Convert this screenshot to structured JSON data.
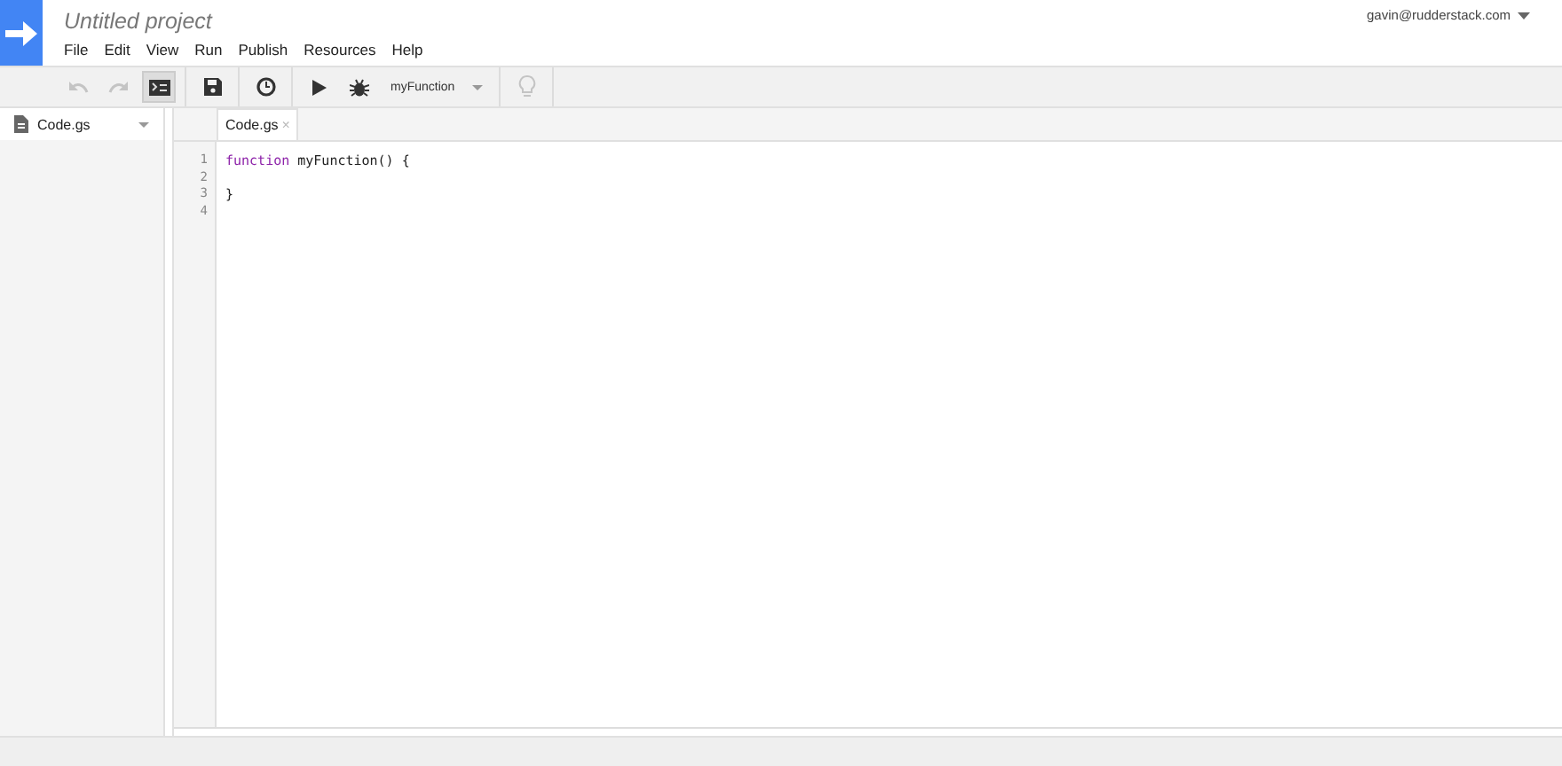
{
  "project": {
    "title": "Untitled project"
  },
  "menu": [
    "File",
    "Edit",
    "View",
    "Run",
    "Publish",
    "Resources",
    "Help"
  ],
  "account": {
    "email": "gavin@rudderstack.com"
  },
  "toolbar": [
    {
      "kind": "undo",
      "disabled": true,
      "pressed": false
    },
    {
      "kind": "redo",
      "disabled": true,
      "pressed": false
    },
    {
      "kind": "log",
      "disabled": false,
      "pressed": true
    },
    {
      "kind": "sep"
    },
    {
      "kind": "save",
      "disabled": false,
      "pressed": false
    },
    {
      "kind": "sep"
    },
    {
      "kind": "clock",
      "disabled": false,
      "pressed": false
    },
    {
      "kind": "sep"
    },
    {
      "kind": "run",
      "disabled": false,
      "pressed": false
    },
    {
      "kind": "debug",
      "disabled": false,
      "pressed": false
    },
    {
      "kind": "select",
      "value": "myFunction"
    },
    {
      "kind": "sep"
    },
    {
      "kind": "bulb",
      "disabled": true,
      "pressed": false
    },
    {
      "kind": "sep"
    }
  ],
  "sidebar": {
    "files": [
      {
        "name": "Code.gs"
      }
    ]
  },
  "tabs": [
    {
      "label": "Code.gs",
      "selected": true,
      "close": "×"
    }
  ],
  "code": [
    {
      "number": "1",
      "tokens": [
        {
          "kind": "keyword",
          "text": "function"
        },
        {
          "kind": "plain",
          "text": " myFunction() {"
        }
      ]
    },
    {
      "number": "2"
    },
    {
      "number": "3",
      "tokens": [
        {
          "kind": "plain",
          "text": "}"
        }
      ]
    },
    {
      "number": "4"
    }
  ]
}
